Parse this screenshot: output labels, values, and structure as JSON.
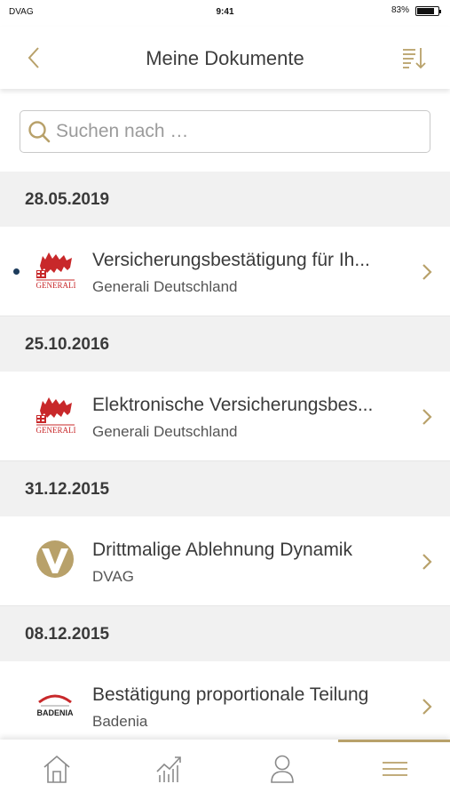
{
  "status": {
    "carrier": "DVAG",
    "time": "9:41",
    "battery": "83%",
    "battery_level": 0.83
  },
  "header": {
    "title": "Meine Dokumente",
    "back_icon": "chevron-left-icon",
    "sort_icon": "sort-icon"
  },
  "search": {
    "placeholder": "Suchen nach …",
    "value": ""
  },
  "groups": [
    {
      "date": "28.05.2019",
      "docs": [
        {
          "title": "Versicherungsbestätigung für Ih...",
          "sender": "Generali Deutschland",
          "logo": "generali-logo",
          "unread": true
        }
      ]
    },
    {
      "date": "25.10.2016",
      "docs": [
        {
          "title": "Elektronische Versicherungsbes...",
          "sender": "Generali Deutschland",
          "logo": "generali-logo",
          "unread": false
        }
      ]
    },
    {
      "date": "31.12.2015",
      "docs": [
        {
          "title": "Drittmalige Ablehnung Dynamik",
          "sender": "DVAG",
          "logo": "dvag-logo",
          "unread": false
        }
      ]
    },
    {
      "date": "08.12.2015",
      "docs": [
        {
          "title": "Bestätigung proportionale Teilung",
          "sender": "Badenia",
          "logo": "badenia-logo",
          "unread": false
        }
      ]
    }
  ],
  "logos": {
    "generali": "GENERALI",
    "badenia": "BADENIA"
  },
  "tabbar": {
    "items": [
      "home-icon",
      "chart-icon",
      "profile-icon",
      "menu-icon"
    ],
    "active": "menu-icon"
  },
  "colors": {
    "accent": "#b8a16a",
    "generali_red": "#c8282a",
    "dot": "#1d3c5c",
    "section_bg": "#f1f1f1"
  }
}
